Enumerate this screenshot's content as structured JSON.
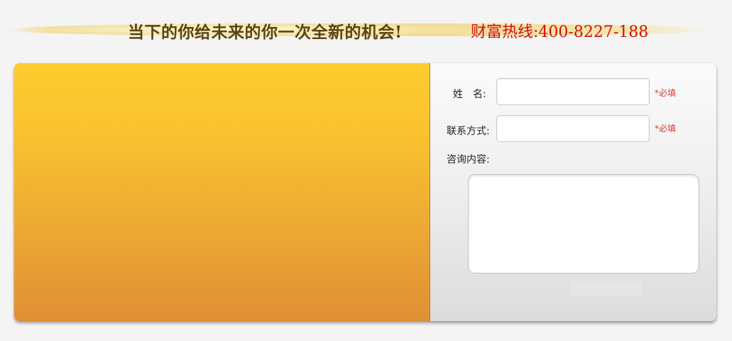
{
  "banner": {
    "slogan": "当下的你给未来的你一次全新的机会!",
    "hotline": "财富热线:400-8227-188"
  },
  "form": {
    "name_label": "姓　名:",
    "name_value": "",
    "name_required": "*必填",
    "contact_label": "联系方式:",
    "contact_value": "",
    "contact_required": "*必填",
    "inquiry_label": "咨询内容:",
    "inquiry_value": "",
    "submit_label": ""
  },
  "colors": {
    "hotline": "#d01111",
    "slogan": "#5a4410",
    "panel_top": "#ffcd2f",
    "panel_bottom": "#e08f35",
    "required": "#dd3333"
  }
}
